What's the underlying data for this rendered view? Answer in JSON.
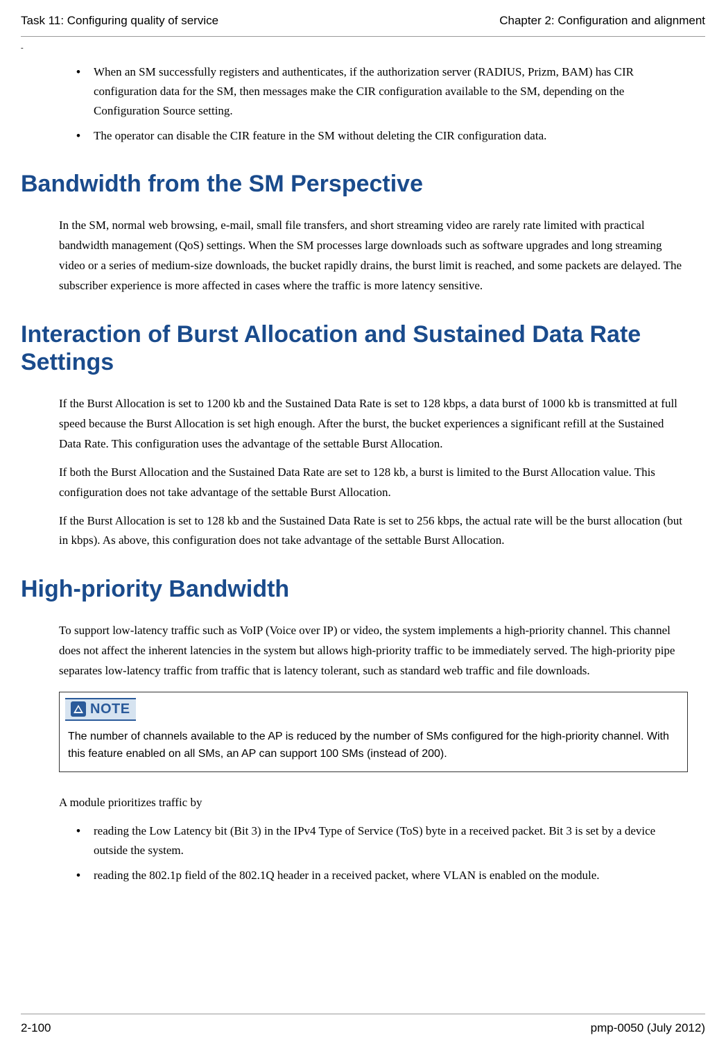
{
  "header": {
    "left": "Task 11: Configuring quality of service",
    "right": "Chapter 2:  Configuration and alignment"
  },
  "dash": "-",
  "list1": {
    "item1": "When an SM successfully registers and authenticates, if the authorization server (RADIUS, Prizm, BAM) has CIR configuration data for the SM, then messages make the CIR configuration available to the SM, depending on the Configuration Source setting.",
    "item2": "The operator can disable the CIR feature in the SM without deleting the CIR configuration data."
  },
  "heading1": "Bandwidth from the SM Perspective",
  "para1": "In the SM, normal web browsing, e-mail, small file transfers, and short streaming video are rarely rate limited with practical bandwidth management (QoS) settings. When the SM processes large downloads such as software upgrades and long streaming video or a series of medium-size downloads, the bucket rapidly drains, the burst limit is reached, and some packets are delayed. The subscriber experience is more affected in cases where the traffic is more latency sensitive.",
  "heading2": "Interaction of Burst Allocation and Sustained Data Rate Settings",
  "para2a": "If the Burst Allocation is set to 1200 kb and the Sustained Data Rate is set to 128 kbps, a data burst of 1000 kb is transmitted at full speed because the Burst Allocation is set high enough. After the burst, the bucket experiences a significant refill at the Sustained Data Rate. This configuration uses the advantage of the settable Burst Allocation.",
  "para2b": "If both the Burst Allocation and the Sustained Data Rate are set to 128 kb, a burst is limited to the Burst Allocation value. This configuration does not take advantage of the settable Burst Allocation.",
  "para2c": "If the Burst Allocation is set to 128 kb and the Sustained Data Rate is set to 256 kbps, the actual rate will be the burst allocation (but in kbps). As above, this configuration does not take advantage of the settable Burst Allocation.",
  "heading3": "High-priority Bandwidth",
  "para3": "To support low-latency traffic such as VoIP (Voice over IP) or video, the system implements a high-priority channel. This channel does not affect the inherent latencies in the system but allows high-priority traffic to be immediately served. The high-priority pipe separates low-latency traffic from traffic that is latency tolerant, such as standard web traffic and file downloads.",
  "note": {
    "label": "NOTE",
    "text": "The number of channels available to the AP is reduced by the number of SMs configured for the high-priority channel. With this feature enabled on all SMs, an AP can support 100 SMs (instead of 200)."
  },
  "para4": "A module prioritizes traffic by",
  "list2": {
    "item1": "reading the Low Latency bit (Bit 3) in the IPv4 Type of Service (ToS) byte in a received packet. Bit 3 is set by a device outside the system.",
    "item2": "reading the 802.1p field of the 802.1Q header in a received packet, where VLAN is enabled on the module."
  },
  "footer": {
    "left": "2-100",
    "right": "pmp-0050 (July 2012)"
  }
}
